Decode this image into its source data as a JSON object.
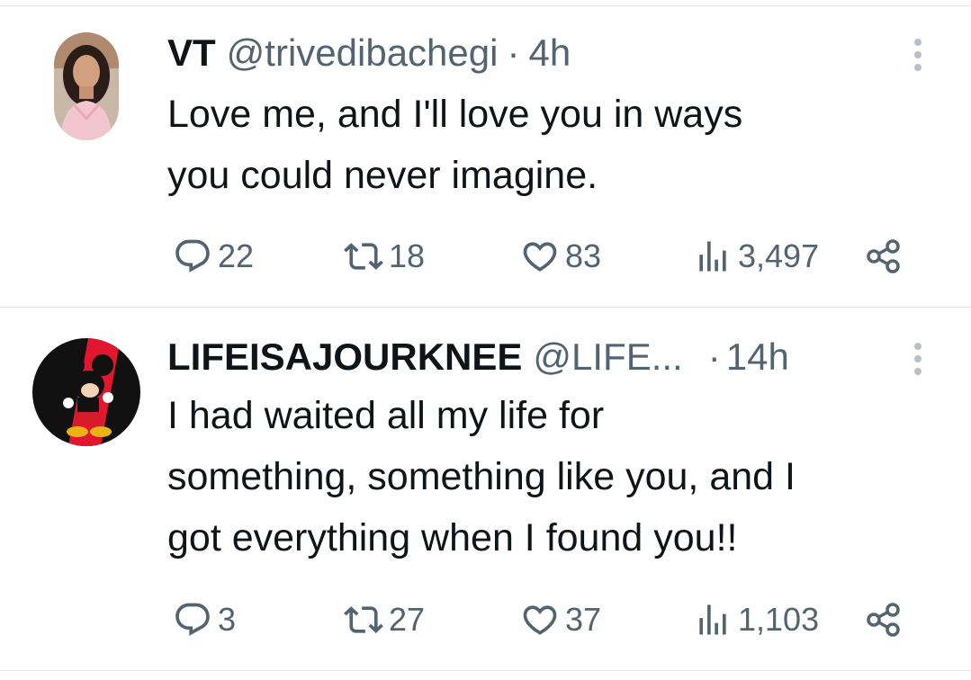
{
  "tweets": [
    {
      "name": "VT",
      "handle": "@trivedibachegi",
      "dot": "·",
      "time": "4h",
      "text": "Love me, and I'll love you in ways\nyou could never imagine.",
      "replies": "22",
      "retweets": "18",
      "likes": "83",
      "views": "3,497"
    },
    {
      "name": "LIFEISAJOURKNEE",
      "handle": "@LIFE...",
      "dot": "·",
      "time": "14h",
      "text": "I had waited all my life for\nsomething, something like you, and I\ngot everything when I found you!!",
      "replies": "3",
      "retweets": "27",
      "likes": "37",
      "views": "1,103"
    }
  ],
  "icons": {
    "reply": "reply-icon",
    "retweet": "retweet-icon",
    "like": "heart-icon",
    "views": "views-icon",
    "share": "share-icon",
    "more": "more-options-icon"
  },
  "colors": {
    "text": "#0f1419",
    "secondary": "#536471",
    "divider": "#e6e9ec",
    "avatar2_red": "#e0172f"
  }
}
